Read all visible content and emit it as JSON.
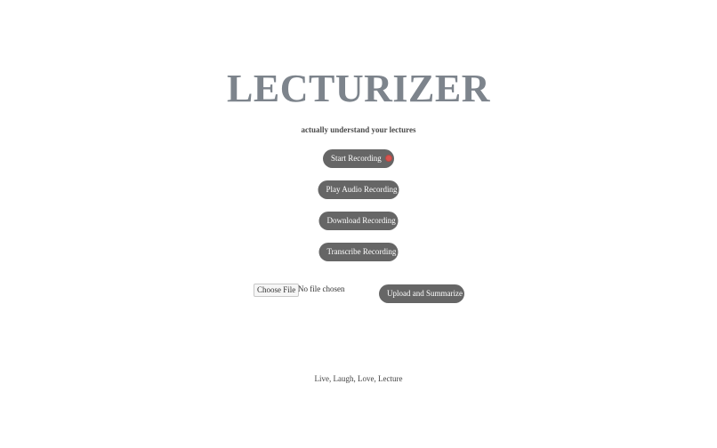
{
  "app": {
    "title": "LECTURIZER",
    "tagline": "actually understand your lectures"
  },
  "buttons": {
    "start_recording": "Start Recording",
    "play_audio": "Play Audio Recording",
    "download": "Download Recording",
    "transcribe": "Transcribe Recording",
    "upload_summarize": "Upload and Summarize"
  },
  "file_input": {
    "button_label": "Choose File",
    "status": "No file chosen"
  },
  "footer": {
    "text": "Live, Laugh, Love, Lecture"
  },
  "icons": {
    "record": "record-dot-icon"
  },
  "colors": {
    "title": "#7d848c",
    "button_bg": "#666666",
    "record_dot": "#d9534f"
  }
}
